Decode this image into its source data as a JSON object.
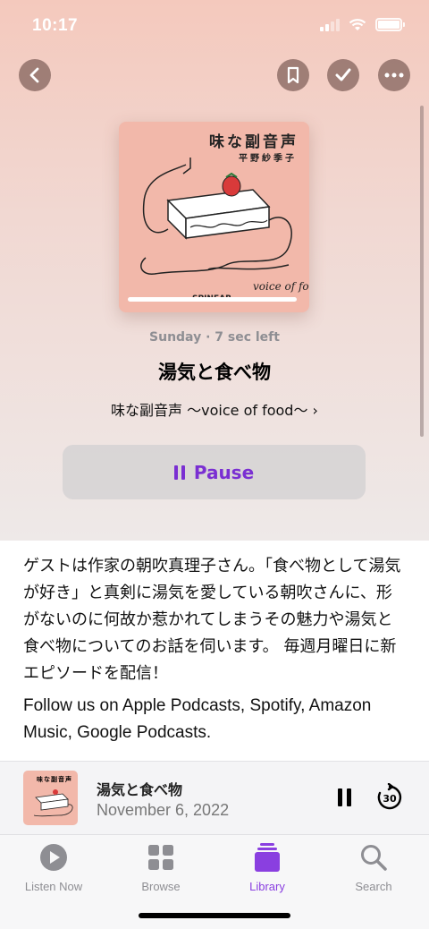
{
  "status_bar": {
    "time": "10:17"
  },
  "episode": {
    "meta": "Sunday · 7 sec left",
    "title": "湯気と食べ物",
    "show_link": "味な副音声 〜voice of food〜 ›",
    "play_button_label": "Pause"
  },
  "artwork": {
    "title": "味な副音声",
    "subtitle": "平野紗季子",
    "script_text": "voice of food",
    "brand": "SPINEAR"
  },
  "description": {
    "body": "ゲストは作家の朝吹真理子さん。「食べ物として湯気が好き」と真剣に湯気を愛している朝吹さんに、形がないのに何故か惹かれてしまうその魅力や湯気と食べ物についてのお話を伺います。 毎週月曜日に新エピソードを配信！",
    "follow": "Follow us on Apple Podcasts, Spotify, Amazon Music, Google Podcasts."
  },
  "mini_player": {
    "title": "湯気と食べ物",
    "date": "November 6, 2022",
    "skip_seconds": "30"
  },
  "tabs": [
    {
      "label": "Listen Now",
      "icon": "play-circle-icon"
    },
    {
      "label": "Browse",
      "icon": "grid-icon"
    },
    {
      "label": "Library",
      "icon": "library-stack-icon"
    },
    {
      "label": "Search",
      "icon": "search-icon"
    }
  ],
  "colors": {
    "accent": "#7a2fd2",
    "artwork_bg": "#f2b8aa",
    "hero_top": "#f4c9bd"
  }
}
